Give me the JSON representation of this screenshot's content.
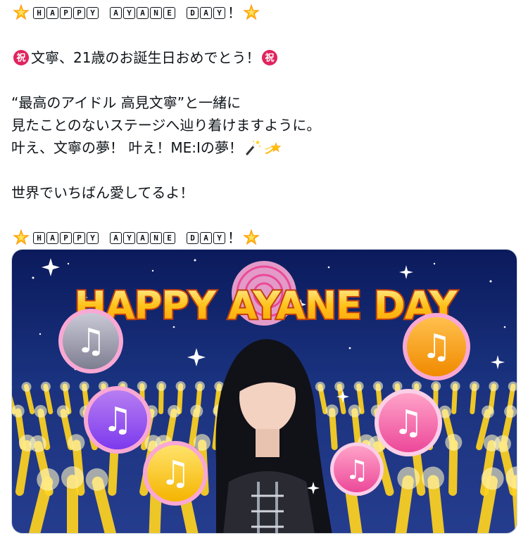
{
  "post": {
    "header_line": {
      "prefix_emoji": "glowing-star",
      "boxed_words": [
        "HAPPY",
        "AYANE",
        "DAY"
      ],
      "suffix": "！",
      "suffix_emoji": "glowing-star"
    },
    "congrats_line": {
      "emoji": "congratulations-ideograph",
      "text": "文寧、21歳のお誕生日おめでとう！"
    },
    "message_lines": [
      "“最高のアイドル 高見文寧”と一緒に",
      "見たことのないステージへ辿り着けますように。",
      "叶え、文寧の夢！ 叶え！ME:Iの夢！"
    ],
    "message_end_emojis": [
      "magic-wand",
      "dizzy"
    ],
    "love_line": "世界でいちばん愛してるよ！",
    "footer_line": {
      "prefix_emoji": "glowing-star",
      "boxed_words": [
        "HAPPY",
        "AYANE",
        "DAY"
      ],
      "suffix": "！",
      "suffix_emoji": "glowing-star"
    }
  },
  "media": {
    "banner_title": "HAPPY AYANE DAY",
    "colors": {
      "sky_top": "#0b1a5c",
      "sky_bottom": "#1e3a8a",
      "penlight": "#ffd21f",
      "title_fill": "#ffc21a",
      "title_stroke": "#c2410c"
    },
    "music_bubbles": [
      "gray",
      "purple",
      "yellow",
      "orange",
      "pink",
      "pink"
    ]
  }
}
